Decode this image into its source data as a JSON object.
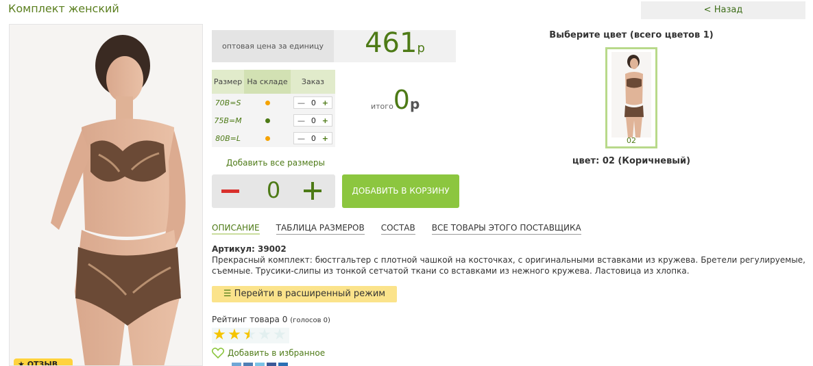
{
  "product": {
    "title": "Комплект женский",
    "back_label": "< Назад",
    "photo_badge": "★ ОТЗЫВ"
  },
  "price": {
    "label": "оптовая цена за единицу",
    "value": "461",
    "currency": "р"
  },
  "sizes_table": {
    "headers": [
      "Размер",
      "На складе",
      "Заказ"
    ],
    "rows": [
      {
        "size": "70B=S",
        "stock_color": "#f5a300",
        "qty": "0"
      },
      {
        "size": "75B=M",
        "stock_color": "#4d7a16",
        "qty": "0"
      },
      {
        "size": "80B=L",
        "stock_color": "#f5a300",
        "qty": "0"
      }
    ]
  },
  "total": {
    "label": "итого",
    "value": "0",
    "currency": "р"
  },
  "order": {
    "add_all_label": "Добавить все размеры",
    "quantity": "0",
    "cart_button": "ДОБАВИТЬ В КОРЗИНУ"
  },
  "tabs": [
    {
      "label": "ОПИСАНИЕ",
      "active": true
    },
    {
      "label": "ТАБЛИЦА РАЗМЕРОВ",
      "active": false
    },
    {
      "label": "СОСТАВ",
      "active": false
    },
    {
      "label": "ВСЕ ТОВАРЫ ЭТОГО ПОСТАВЩИКА",
      "active": false
    }
  ],
  "details": {
    "article": "Артикул: 39002",
    "description": "Прекрасный комплект: бюстгальтер с плотной чашкой на косточках, с оригинальными вставками из кружева. Бретели регулируемые, съемные. Трусики-слипы из тонкой сетчатой ткани со вставками из нежного кружева. Ластовица из хлопка.",
    "extended_mode_button": "Перейти в расширенный режим"
  },
  "rating": {
    "label": "Рейтинг товара 0",
    "votes": "(голосов 0)",
    "stars_value": 2.5,
    "stars_max": 5
  },
  "favorites_label": "Добавить в избранное",
  "colors": {
    "heading": "Выберите цвет (всего цветов 1)",
    "swatch_label": "02",
    "selected": "цвет: 02 (Коричневый)"
  },
  "icons": {
    "list": "list-icon",
    "heart": "heart-icon",
    "star": "star-icon"
  },
  "accent_colors": {
    "green": "#4d7a16",
    "button_green": "#8cc63f",
    "minus_red": "#d9302c",
    "yellow_button": "#fbe38b"
  }
}
